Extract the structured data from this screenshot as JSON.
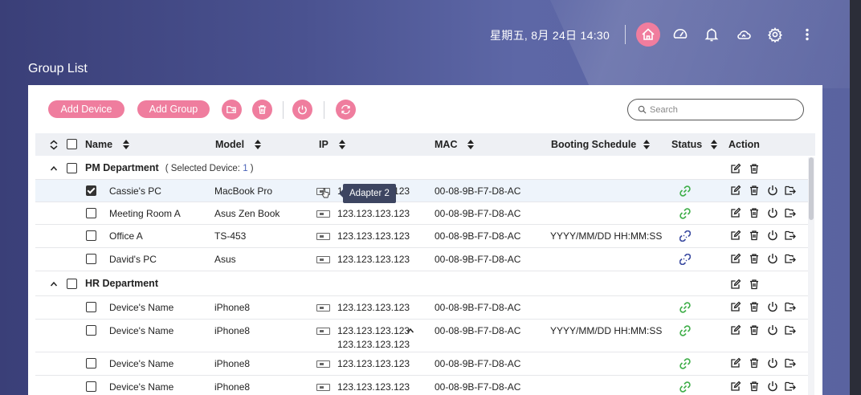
{
  "header": {
    "datetime": "星期五, 8月 24日 14:30",
    "icons": [
      "home-icon",
      "dashboard-icon",
      "bell-icon",
      "cloud-icon",
      "gear-icon",
      "more-icon"
    ]
  },
  "page_title": "Group List",
  "toolbar": {
    "add_device": "Add Device",
    "add_group": "Add Group",
    "icons": [
      "move-to-folder-icon",
      "trash-icon",
      "power-icon",
      "refresh-icon"
    ],
    "search_placeholder": "Search"
  },
  "columns": {
    "name": "Name",
    "model": "Model",
    "ip": "IP",
    "mac": "MAC",
    "booting_schedule": "Booting Schedule",
    "status": "Status",
    "action": "Action"
  },
  "groups": [
    {
      "name": "PM Department",
      "selected_prefix": "( Selected Device: ",
      "selected_count": "1",
      "selected_suffix": " )"
    },
    {
      "name": "HR Department"
    }
  ],
  "devices": [
    {
      "name": "Cassie's PC",
      "model": "MacBook Pro",
      "ip": "123.123.123.123",
      "mac": "00-08-9B-F7-D8-AC",
      "schedule": "",
      "status": "connected",
      "checked": true
    },
    {
      "name": "Meeting Room A",
      "model": "Asus Zen Book",
      "ip": "123.123.123.123",
      "mac": "00-08-9B-F7-D8-AC",
      "schedule": "",
      "status": "connected",
      "checked": false
    },
    {
      "name": "Office A",
      "model": "TS-453",
      "ip": "123.123.123.123",
      "mac": "00-08-9B-F7-D8-AC",
      "schedule": "YYYY/MM/DD HH:MM:SS",
      "status": "disconnected",
      "checked": false
    },
    {
      "name": "David's PC",
      "model": "Asus",
      "ip": "123.123.123.123",
      "mac": "00-08-9B-F7-D8-AC",
      "schedule": "",
      "status": "disconnected",
      "checked": false
    },
    {
      "name": "Device's Name",
      "model": "iPhone8",
      "ip": "123.123.123.123",
      "mac": "00-08-9B-F7-D8-AC",
      "schedule": "",
      "status": "connected",
      "checked": false
    },
    {
      "name": "Device's Name",
      "model": "iPhone8",
      "ip": "123.123.123.123",
      "ip2": "123.123.123.123",
      "mac": "00-08-9B-F7-D8-AC",
      "schedule": "YYYY/MM/DD HH:MM:SS",
      "status": "connected",
      "checked": false
    },
    {
      "name": "Device's Name",
      "model": "iPhone8",
      "ip": "123.123.123.123",
      "mac": "00-08-9B-F7-D8-AC",
      "schedule": "",
      "status": "connected",
      "checked": false
    },
    {
      "name": "Device's Name",
      "model": "iPhone8",
      "ip": "123.123.123.123",
      "mac": "00-08-9B-F7-D8-AC",
      "schedule": "",
      "status": "connected",
      "checked": false
    }
  ],
  "tooltip": "Adapter 2",
  "colors": {
    "accent": "#ef7d9e",
    "connected": "#3fae49",
    "disconnected": "#3a4aa0",
    "tooltip_bg": "#3d4561"
  }
}
